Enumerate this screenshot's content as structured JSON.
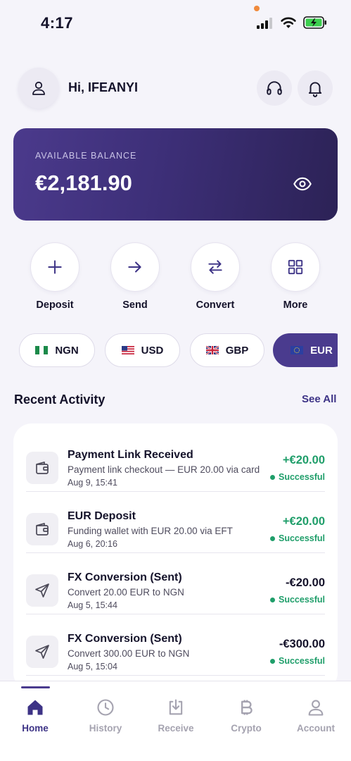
{
  "status_bar": {
    "time": "4:17"
  },
  "header": {
    "greeting": "Hi, IFEANYI"
  },
  "balance": {
    "label": "AVAILABLE BALANCE",
    "amount": "€2,181.90"
  },
  "actions": [
    {
      "label": "Deposit",
      "icon": "plus-icon"
    },
    {
      "label": "Send",
      "icon": "arrow-right-icon"
    },
    {
      "label": "Convert",
      "icon": "swap-icon"
    },
    {
      "label": "More",
      "icon": "grid-icon"
    }
  ],
  "currencies": [
    {
      "code": "NGN",
      "flag": "nigeria-flag"
    },
    {
      "code": "USD",
      "flag": "usa-flag"
    },
    {
      "code": "GBP",
      "flag": "uk-flag"
    },
    {
      "code": "EUR",
      "flag": "eu-flag",
      "selected": true
    }
  ],
  "recent_activity": {
    "title": "Recent Activity",
    "see_all": "See All",
    "items": [
      {
        "icon": "wallet-icon",
        "title": "Payment Link Received",
        "description": "Payment link checkout — EUR 20.00 via card",
        "date": "Aug 9, 15:41",
        "amount": "+€20.00",
        "status": "Successful"
      },
      {
        "icon": "wallet-icon",
        "title": "EUR Deposit",
        "description": "Funding wallet with EUR 20.00 via EFT",
        "date": "Aug 6, 20:16",
        "amount": "+€20.00",
        "status": "Successful"
      },
      {
        "icon": "send-icon",
        "title": "FX Conversion (Sent)",
        "description": "Convert 20.00 EUR to NGN",
        "date": "Aug 5, 15:44",
        "amount": "-€20.00",
        "status": "Successful"
      },
      {
        "icon": "send-icon",
        "title": "FX Conversion (Sent)",
        "description": "Convert 300.00 EUR to NGN",
        "date": "Aug 5, 15:04",
        "amount": "-€300.00",
        "status": "Successful"
      }
    ]
  },
  "nav": [
    {
      "label": "Home",
      "icon": "home-icon",
      "active": true
    },
    {
      "label": "History",
      "icon": "clock-icon"
    },
    {
      "label": "Receive",
      "icon": "download-icon"
    },
    {
      "label": "Crypto",
      "icon": "bitcoin-icon"
    },
    {
      "label": "Account",
      "icon": "user-icon"
    }
  ],
  "colors": {
    "primary": "#4a3b8e",
    "success": "#1f9e6a",
    "background": "#f5f4fa"
  }
}
